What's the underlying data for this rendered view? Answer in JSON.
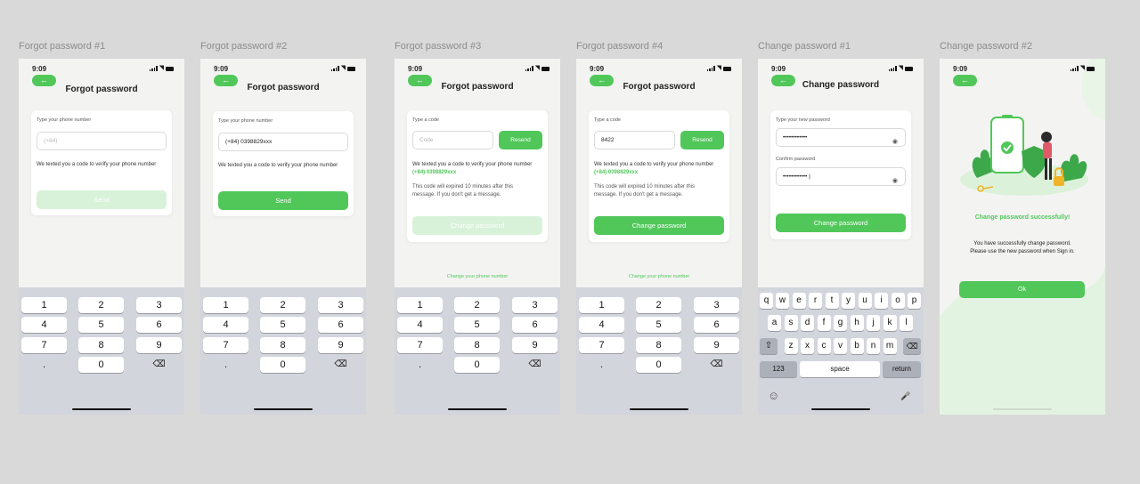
{
  "status_time": "9:09",
  "screens": [
    {
      "frame_title": "Forgot password #1",
      "title": "Forgot password",
      "phone_label": "Type your phone number",
      "phone_placeholder": "(+84)",
      "message": "We texted you a code to verify your phone number",
      "send_label": "Send",
      "send_enabled": false
    },
    {
      "frame_title": "Forgot password #2",
      "title": "Forgot password",
      "phone_label": "Type your phone number",
      "phone_value": "(+84) 0398829xxx",
      "message": "We texted you a code to verify your phone number",
      "send_label": "Send",
      "send_enabled": true
    },
    {
      "frame_title": "Forgot password #3",
      "title": "Forgot password",
      "code_label": "Type a code",
      "code_placeholder": "Code",
      "resend_label": "Resend",
      "message": "We texted you a code to verify your phone number",
      "phone_highlight": "(+84) 0398829xxx",
      "expiry_text": "This code will expired 10 minutes after this message. If you don't get a message.",
      "change_label": "Change password",
      "change_enabled": false,
      "change_phone_link": "Change your phone number"
    },
    {
      "frame_title": "Forgot password #4",
      "title": "Forgot password",
      "code_label": "Type a code",
      "code_value": "8422",
      "resend_label": "Resend",
      "message": "We texted you a code to verify your phone number",
      "phone_highlight": "(+84) 0398829xxx",
      "expiry_text": "This code will expired 10 minutes after this message. If you don't get a message.",
      "change_label": "Change password",
      "change_enabled": true,
      "change_phone_link": "Change your phone number"
    },
    {
      "frame_title": "Change password #1",
      "title": "Change password",
      "new_label": "Type your new password",
      "new_value": "••••••••••••",
      "confirm_label": "Confirm password",
      "confirm_value": "•••••••••••• |",
      "button_label": "Change password"
    },
    {
      "frame_title": "Change password #2",
      "success_title": "Change password successfully!",
      "success_line1": "You have successfully change password.",
      "success_line2": "Please use the new password when Sign in.",
      "ok_label": "Ok"
    }
  ],
  "numpad": {
    "keys": [
      "1",
      "2",
      "3",
      "4",
      "5",
      "6",
      "7",
      "8",
      "9",
      ".",
      "0",
      "⌫"
    ]
  },
  "keyboard": {
    "row1": [
      "q",
      "w",
      "e",
      "r",
      "t",
      "y",
      "u",
      "i",
      "o",
      "p"
    ],
    "row2": [
      "a",
      "s",
      "d",
      "f",
      "g",
      "h",
      "j",
      "k",
      "l"
    ],
    "row3": [
      "z",
      "x",
      "c",
      "v",
      "b",
      "n",
      "m"
    ],
    "shift": "⇧",
    "delete": "⌫",
    "numbers_key": "123",
    "space_key": "space",
    "return_key": "return",
    "emoji": "☺",
    "mic": "🎤"
  },
  "icons": {
    "back": "←"
  },
  "colors": {
    "accent": "#51c75a",
    "accent_disabled": "#d7f2d9",
    "background": "#d9d9d9",
    "screen_bg": "#f3f4f2"
  }
}
